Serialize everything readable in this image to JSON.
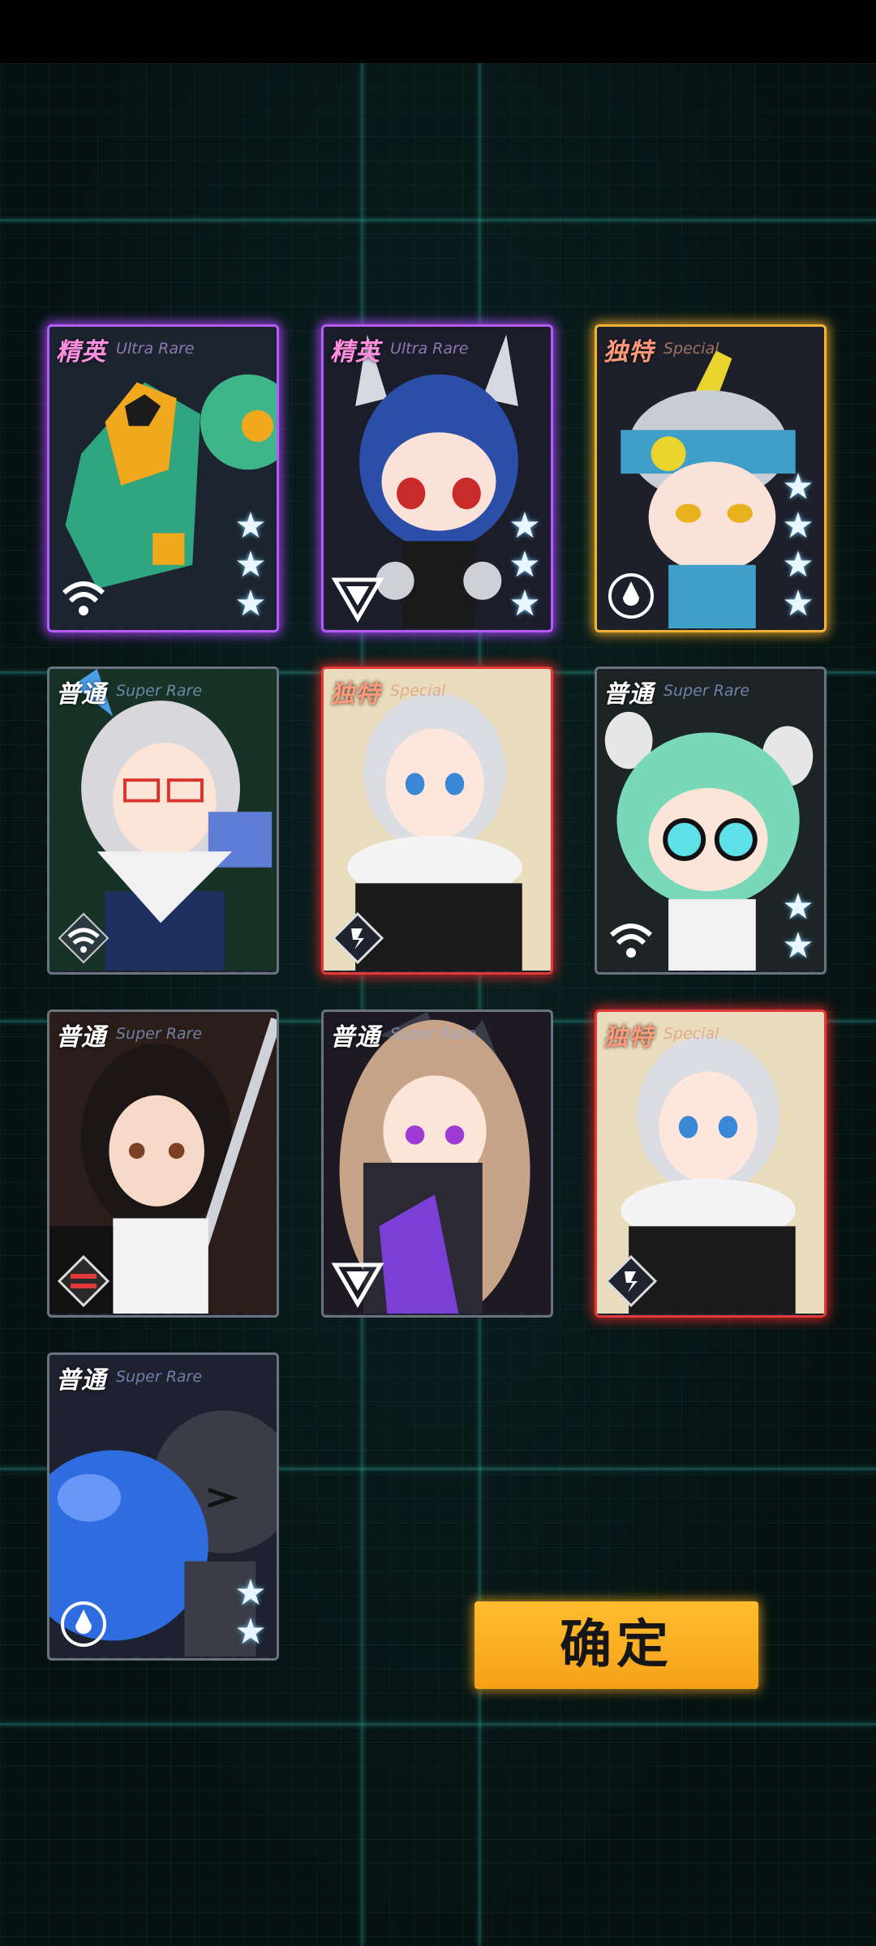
{
  "cards": [
    {
      "rank": "精英",
      "subtitle": "Ultra Rare",
      "stars": "3"
    },
    {
      "rank": "精英",
      "subtitle": "Ultra Rare",
      "stars": "3"
    },
    {
      "rank": "独特",
      "subtitle": "Special",
      "stars": "4"
    },
    {
      "rank": "普通",
      "subtitle": "Super Rare",
      "stars": "0"
    },
    {
      "rank": "独特",
      "subtitle": "Special",
      "stars": "0"
    },
    {
      "rank": "普通",
      "subtitle": "Super Rare",
      "stars": "2"
    },
    {
      "rank": "普通",
      "subtitle": "Super Rare",
      "stars": "0"
    },
    {
      "rank": "普通",
      "subtitle": "Super Rare",
      "stars": "0"
    },
    {
      "rank": "独特",
      "subtitle": "Special",
      "stars": "0"
    },
    {
      "rank": "普通",
      "subtitle": "Super Rare",
      "stars": "2"
    }
  ],
  "confirm_label": "确定",
  "colors": {
    "elite": "#b65bff",
    "unique_gold": "#f4b234",
    "unique_red": "#e23a3a",
    "normal": "#6b7380",
    "confirm": "#f5a117"
  },
  "icons": [
    "wifi-class-icon",
    "triangle-class-icon",
    "drop-class-icon",
    "diamond-class-icon",
    "stripe-class-icon"
  ]
}
